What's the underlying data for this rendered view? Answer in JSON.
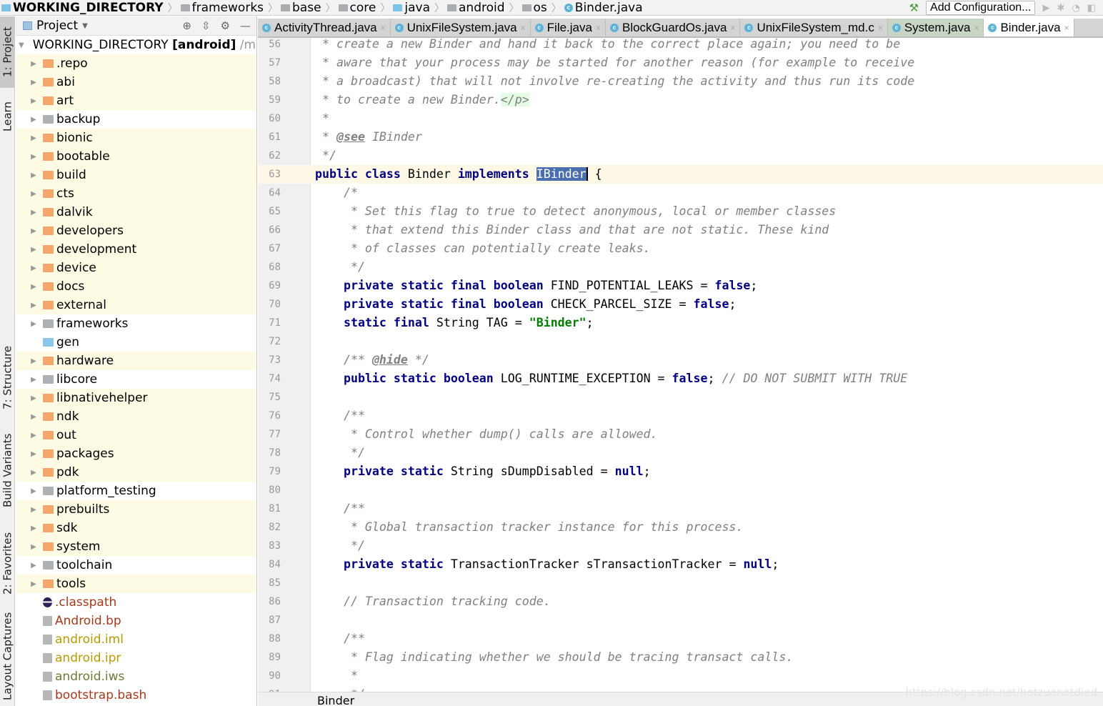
{
  "breadcrumb": [
    {
      "label": "WORKING_DIRECTORY",
      "icon": "module-icon",
      "bold": true
    },
    {
      "label": "frameworks",
      "icon": "folder-icon"
    },
    {
      "label": "base",
      "icon": "folder-icon"
    },
    {
      "label": "core",
      "icon": "folder-icon"
    },
    {
      "label": "java",
      "icon": "source-folder-icon"
    },
    {
      "label": "android",
      "icon": "package-icon"
    },
    {
      "label": "os",
      "icon": "package-icon"
    },
    {
      "label": "Binder.java",
      "icon": "class-icon"
    }
  ],
  "toolbar": {
    "add_configuration": "Add Configuration..."
  },
  "tool_strip": [
    "1: Project",
    "Learn",
    "7: Structure",
    "Build Variants",
    "2: Favorites",
    "Layout Captures"
  ],
  "project": {
    "title": "Project",
    "root": {
      "name": "WORKING_DIRECTORY",
      "module": "[android]",
      "path": "/med"
    },
    "items": [
      {
        "name": ".repo",
        "kind": "orange"
      },
      {
        "name": "abi",
        "kind": "orange"
      },
      {
        "name": "art",
        "kind": "orange"
      },
      {
        "name": "backup",
        "kind": "gray"
      },
      {
        "name": "bionic",
        "kind": "orange"
      },
      {
        "name": "bootable",
        "kind": "orange"
      },
      {
        "name": "build",
        "kind": "orange"
      },
      {
        "name": "cts",
        "kind": "orange"
      },
      {
        "name": "dalvik",
        "kind": "orange"
      },
      {
        "name": "developers",
        "kind": "orange"
      },
      {
        "name": "development",
        "kind": "orange"
      },
      {
        "name": "device",
        "kind": "orange"
      },
      {
        "name": "docs",
        "kind": "orange"
      },
      {
        "name": "external",
        "kind": "orange"
      },
      {
        "name": "frameworks",
        "kind": "gray"
      },
      {
        "name": "gen",
        "kind": "gen"
      },
      {
        "name": "hardware",
        "kind": "orange"
      },
      {
        "name": "libcore",
        "kind": "gray"
      },
      {
        "name": "libnativehelper",
        "kind": "orange"
      },
      {
        "name": "ndk",
        "kind": "orange"
      },
      {
        "name": "out",
        "kind": "orange"
      },
      {
        "name": "packages",
        "kind": "orange"
      },
      {
        "name": "pdk",
        "kind": "orange"
      },
      {
        "name": "platform_testing",
        "kind": "gray"
      },
      {
        "name": "prebuilts",
        "kind": "orange"
      },
      {
        "name": "sdk",
        "kind": "orange"
      },
      {
        "name": "system",
        "kind": "orange"
      },
      {
        "name": "toolchain",
        "kind": "gray"
      },
      {
        "name": "tools",
        "kind": "orange"
      },
      {
        "name": ".classpath",
        "kind": "file",
        "color": "#a63a1d",
        "icon": "eclipse"
      },
      {
        "name": "Android.bp",
        "kind": "file",
        "color": "#a63a1d"
      },
      {
        "name": "android.iml",
        "kind": "file",
        "color": "#b89b00"
      },
      {
        "name": "android.ipr",
        "kind": "file",
        "color": "#b89b00"
      },
      {
        "name": "android.iws",
        "kind": "file",
        "color": "#6d7a3a"
      },
      {
        "name": "bootstrap.bash",
        "kind": "file",
        "color": "#a63a1d"
      }
    ]
  },
  "tabs": [
    {
      "label": "ActivityThread.java"
    },
    {
      "label": "UnixFileSystem.java"
    },
    {
      "label": "File.java"
    },
    {
      "label": "BlockGuardOs.java"
    },
    {
      "label": "UnixFileSystem_md.c"
    },
    {
      "label": "System.java",
      "style": "sys"
    },
    {
      "label": "Binder.java",
      "active": true
    }
  ],
  "editor": {
    "current_line": 63,
    "lines": [
      {
        "n": 56,
        "t": [
          [
            "c",
            " * create a new Binder and hand it back to the correct place again; you need to be"
          ]
        ]
      },
      {
        "n": 57,
        "t": [
          [
            "c",
            " * aware that your process may be started for another reason (for example to receive"
          ]
        ]
      },
      {
        "n": 58,
        "t": [
          [
            "c",
            " * a broadcast) that will not involve re-creating the activity and thus run its code"
          ]
        ]
      },
      {
        "n": 59,
        "t": [
          [
            "c",
            " * to create a new Binder."
          ],
          [
            "html",
            "</p>"
          ]
        ]
      },
      {
        "n": 60,
        "t": [
          [
            "c",
            " *"
          ]
        ]
      },
      {
        "n": 61,
        "t": [
          [
            "c",
            " * "
          ],
          [
            "tag",
            "@see"
          ],
          [
            "c",
            " IBinder"
          ]
        ]
      },
      {
        "n": 62,
        "t": [
          [
            "c",
            " */"
          ]
        ]
      },
      {
        "n": 63,
        "t": [
          [
            "k",
            "public class "
          ],
          [
            "t",
            "Binder "
          ],
          [
            "k",
            "implements "
          ],
          [
            "sel",
            "IBinder"
          ],
          [
            "t",
            " {"
          ]
        ]
      },
      {
        "n": 64,
        "t": [
          [
            "c",
            "    /*"
          ]
        ]
      },
      {
        "n": 65,
        "t": [
          [
            "c",
            "     * Set this flag to true to detect anonymous, local or member classes"
          ]
        ]
      },
      {
        "n": 66,
        "t": [
          [
            "c",
            "     * that extend this Binder class and that are not static. These kind"
          ]
        ]
      },
      {
        "n": 67,
        "t": [
          [
            "c",
            "     * of classes can potentially create leaks."
          ]
        ]
      },
      {
        "n": 68,
        "t": [
          [
            "c",
            "     */"
          ]
        ]
      },
      {
        "n": 69,
        "t": [
          [
            "t",
            "    "
          ],
          [
            "k",
            "private static final boolean "
          ],
          [
            "t",
            "FIND_POTENTIAL_LEAKS = "
          ],
          [
            "k",
            "false"
          ],
          [
            "t",
            ";"
          ]
        ]
      },
      {
        "n": 70,
        "t": [
          [
            "t",
            "    "
          ],
          [
            "k",
            "private static final boolean "
          ],
          [
            "t",
            "CHECK_PARCEL_SIZE = "
          ],
          [
            "k",
            "false"
          ],
          [
            "t",
            ";"
          ]
        ]
      },
      {
        "n": 71,
        "t": [
          [
            "t",
            "    "
          ],
          [
            "k",
            "static final "
          ],
          [
            "t",
            "String TAG = "
          ],
          [
            "s",
            "\"Binder\""
          ],
          [
            "t",
            ";"
          ]
        ]
      },
      {
        "n": 72,
        "t": []
      },
      {
        "n": 73,
        "t": [
          [
            "c",
            "    /** "
          ],
          [
            "tag",
            "@hide"
          ],
          [
            "c",
            " */"
          ]
        ]
      },
      {
        "n": 74,
        "t": [
          [
            "t",
            "    "
          ],
          [
            "k",
            "public static boolean "
          ],
          [
            "t",
            "LOG_RUNTIME_EXCEPTION = "
          ],
          [
            "k",
            "false"
          ],
          [
            "t",
            "; "
          ],
          [
            "c",
            "// DO NOT SUBMIT WITH TRUE"
          ]
        ]
      },
      {
        "n": 75,
        "t": []
      },
      {
        "n": 76,
        "t": [
          [
            "c",
            "    /**"
          ]
        ]
      },
      {
        "n": 77,
        "t": [
          [
            "c",
            "     * Control whether dump() calls are allowed."
          ]
        ]
      },
      {
        "n": 78,
        "t": [
          [
            "c",
            "     */"
          ]
        ]
      },
      {
        "n": 79,
        "t": [
          [
            "t",
            "    "
          ],
          [
            "k",
            "private static "
          ],
          [
            "t",
            "String sDumpDisabled = "
          ],
          [
            "k",
            "null"
          ],
          [
            "t",
            ";"
          ]
        ]
      },
      {
        "n": 80,
        "t": []
      },
      {
        "n": 81,
        "t": [
          [
            "c",
            "    /**"
          ]
        ]
      },
      {
        "n": 82,
        "t": [
          [
            "c",
            "     * Global transaction tracker instance for this process."
          ]
        ]
      },
      {
        "n": 83,
        "t": [
          [
            "c",
            "     */"
          ]
        ]
      },
      {
        "n": 84,
        "t": [
          [
            "t",
            "    "
          ],
          [
            "k",
            "private static "
          ],
          [
            "t",
            "TransactionTracker sTransactionTracker = "
          ],
          [
            "k",
            "null"
          ],
          [
            "t",
            ";"
          ]
        ]
      },
      {
        "n": 85,
        "t": []
      },
      {
        "n": 86,
        "t": [
          [
            "c",
            "    // Transaction tracking code."
          ]
        ]
      },
      {
        "n": 87,
        "t": []
      },
      {
        "n": 88,
        "t": [
          [
            "c",
            "    /**"
          ]
        ]
      },
      {
        "n": 89,
        "t": [
          [
            "c",
            "     * Flag indicating whether we should be tracing transact calls."
          ]
        ]
      },
      {
        "n": 90,
        "t": [
          [
            "c",
            "     *"
          ]
        ]
      },
      {
        "n": 91,
        "t": [
          [
            "c",
            "     */"
          ]
        ]
      }
    ]
  },
  "status": {
    "breadcrumb": "Binder"
  },
  "watermark": "https://blog.csdn.net/hotzuonotdied"
}
